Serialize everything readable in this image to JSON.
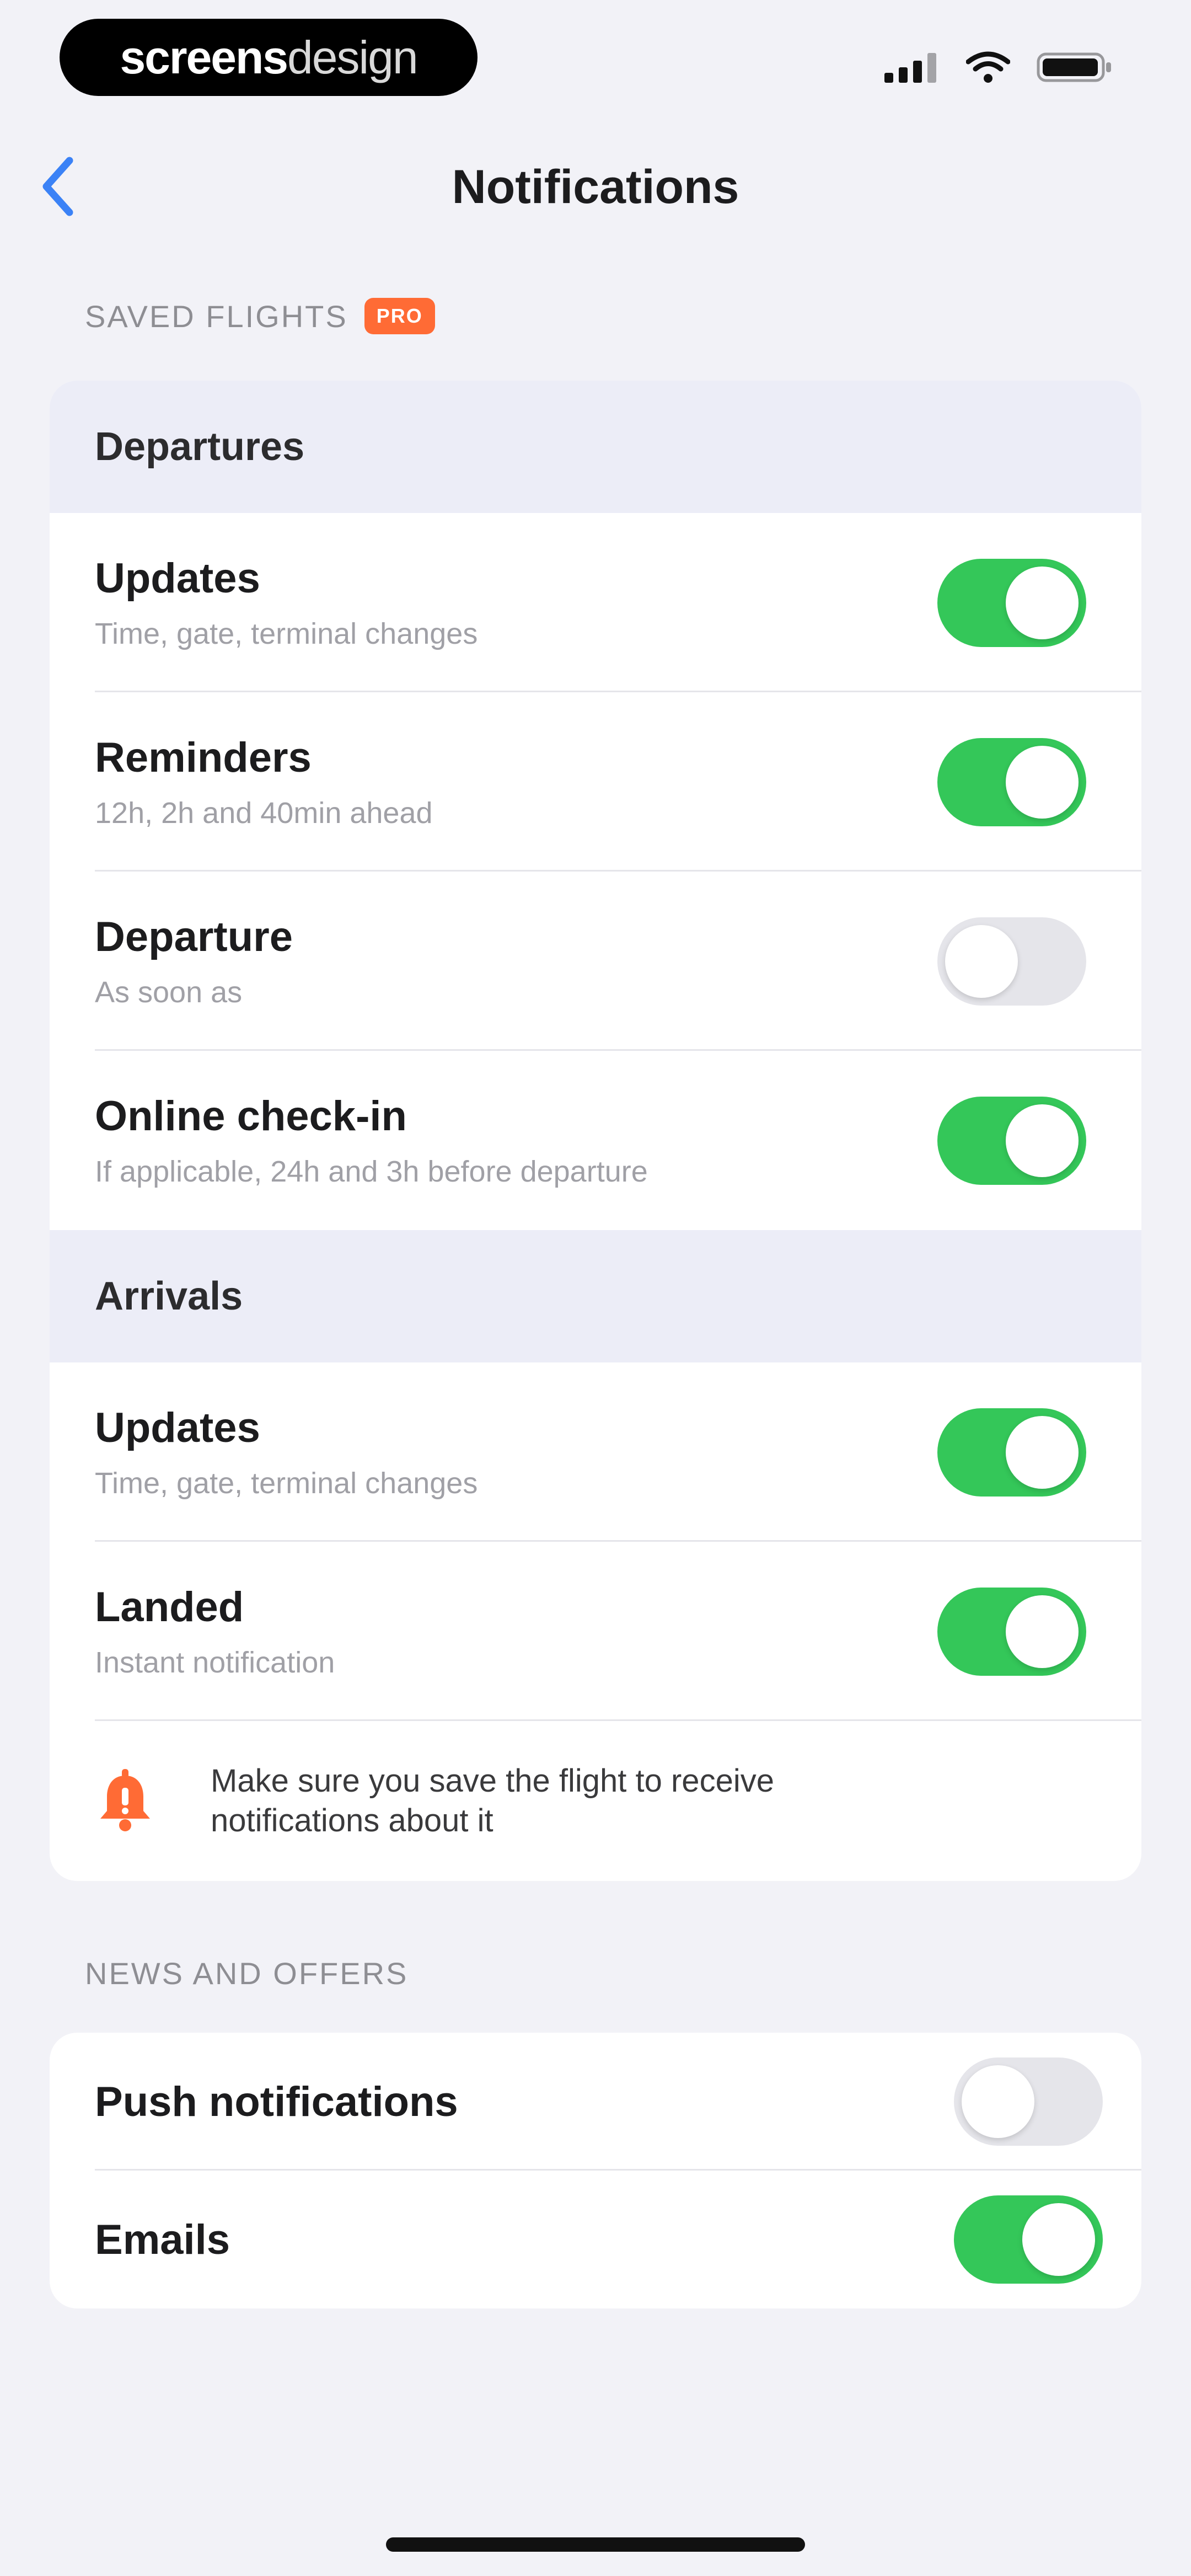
{
  "status_bar": {
    "brand_bold": "screens",
    "brand_light": "design"
  },
  "nav": {
    "title": "Notifications"
  },
  "saved_flights": {
    "section_label": "SAVED FLIGHTS",
    "badge": "PRO",
    "departures": {
      "header": "Departures",
      "items": [
        {
          "title": "Updates",
          "subtitle": "Time, gate, terminal changes",
          "on": true
        },
        {
          "title": "Reminders",
          "subtitle": "12h, 2h and 40min ahead",
          "on": true
        },
        {
          "title": "Departure",
          "subtitle": "As soon as",
          "on": false
        },
        {
          "title": "Online check-in",
          "subtitle": "If applicable, 24h and 3h before departure",
          "on": true
        }
      ]
    },
    "arrivals": {
      "header": "Arrivals",
      "items": [
        {
          "title": "Updates",
          "subtitle": "Time, gate, terminal changes",
          "on": true
        },
        {
          "title": "Landed",
          "subtitle": "Instant notification",
          "on": true
        }
      ]
    },
    "info_text": "Make sure you save the flight to receive notifications about it"
  },
  "news_offers": {
    "section_label": "NEWS AND OFFERS",
    "items": [
      {
        "title": "Push notifications",
        "on": false
      },
      {
        "title": "Emails",
        "on": true
      }
    ]
  },
  "colors": {
    "accent_blue": "#3B82F6",
    "toggle_on": "#34C759",
    "toggle_off": "#E5E5EA",
    "badge_orange": "#FF6B35",
    "group_header_bg": "#ECEDF7"
  }
}
